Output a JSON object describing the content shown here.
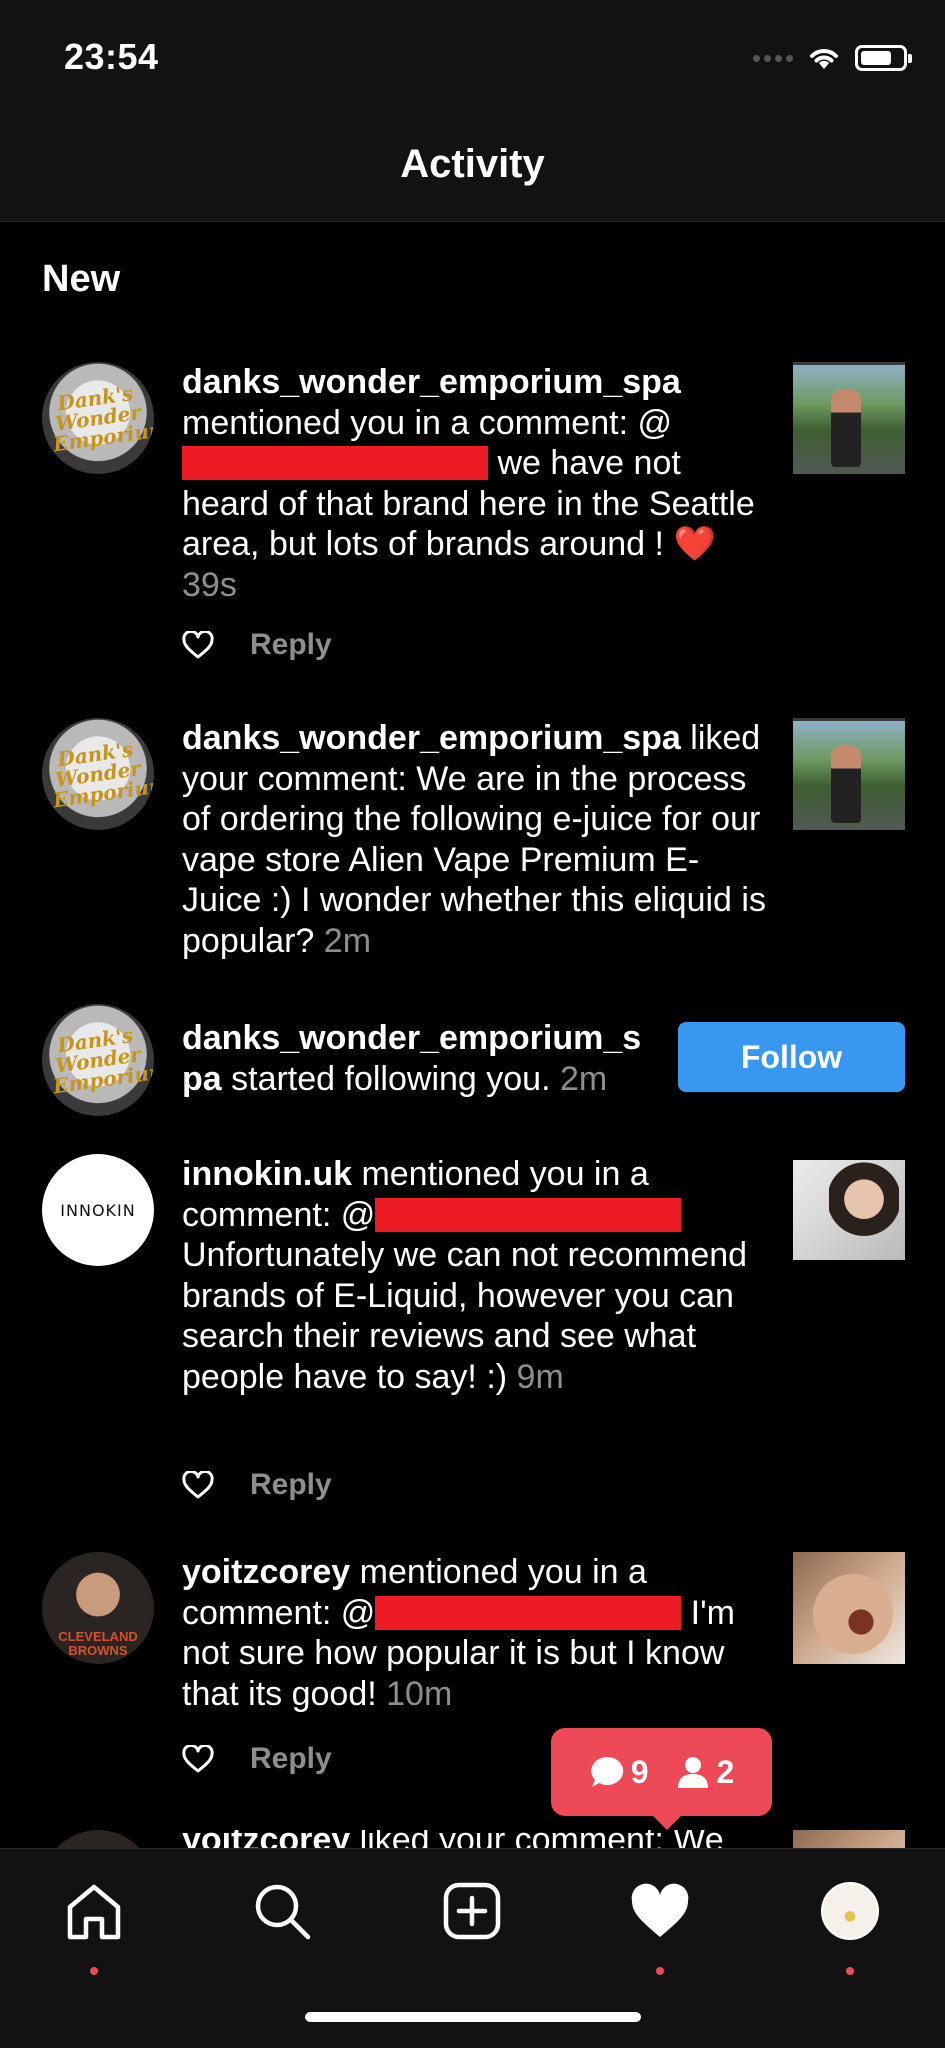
{
  "status_bar": {
    "time": "23:54"
  },
  "header": {
    "title": "Activity"
  },
  "section": {
    "label": "New"
  },
  "items": [
    {
      "username": "danks_wonder_emporium_spa",
      "text_before": " mentioned you in a comment: @",
      "text_after": " we have not heard of that brand here in the Seattle area, but lots of brands around ! ",
      "emoji": "❤️",
      "time": "39s",
      "reply_label": "Reply",
      "avatar_text": "Dank's Wonder Emporium"
    },
    {
      "username": "danks_wonder_emporium_spa",
      "text": " liked your comment: We are in the process of ordering the following e-juice for our vape store Alien Vape Premium E-Juice :) I wonder whether this eliquid is popular? ",
      "time": "2m",
      "avatar_text": "Dank's Wonder Emporium"
    },
    {
      "username": "danks_wonder_emporium_spa",
      "text": " started following you. ",
      "time": "2m",
      "follow_label": "Follow",
      "avatar_text": "Dank's Wonder Emporium"
    },
    {
      "username": "innokin.uk",
      "text_before": " mentioned you in a comment: @",
      "text_after": " Unfortunately we can not recommend brands of E-Liquid, however you can search their reviews and see what people have to say! :) ",
      "time": "9m",
      "reply_label": "Reply",
      "avatar_text": "INNOKIN"
    },
    {
      "username": "yoitzcorey",
      "text_before": " mentioned you in a comment: @",
      "text_after": " I'm not sure how popular it is but I know that its good! ",
      "time": "10m",
      "reply_label": "Reply",
      "avatar_text": "CLEVELAND BROWNS"
    },
    {
      "username": "yoitzcorey",
      "text": " liked your comment: We"
    }
  ],
  "notification_bubble": {
    "comments_count": "9",
    "followers_count": "2"
  },
  "tabbar": {
    "tabs": [
      "home",
      "search",
      "new-post",
      "activity",
      "profile"
    ]
  },
  "colors": {
    "accent": "#3897f0",
    "notification": "#ed4956",
    "redaction": "#ed1c24"
  }
}
